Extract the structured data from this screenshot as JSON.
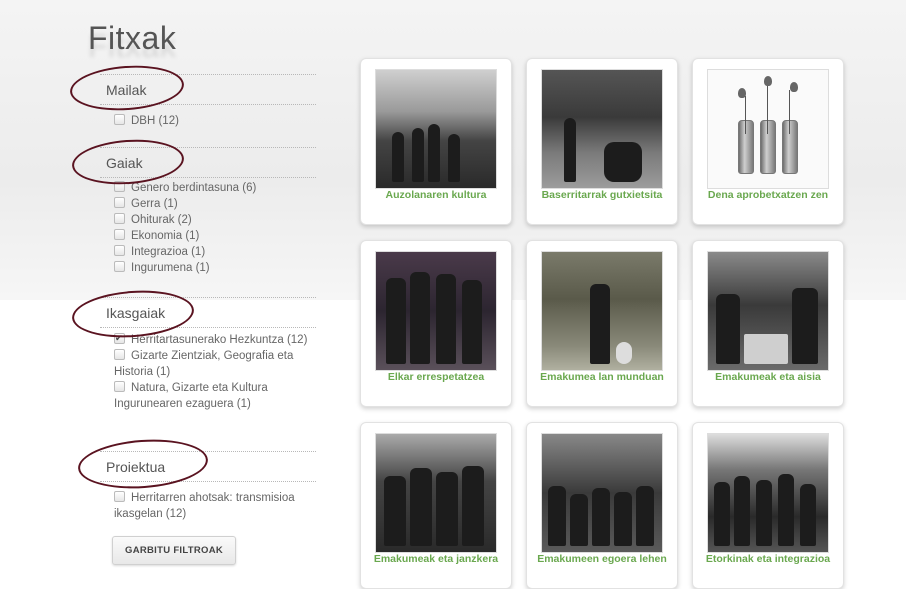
{
  "page": {
    "title": "Fitxak"
  },
  "filters": [
    {
      "heading": "Mailak",
      "items": [
        {
          "label": "DBH (12)",
          "checked": false
        }
      ]
    },
    {
      "heading": "Gaiak",
      "items": [
        {
          "label": "Genero berdintasuna (6)",
          "checked": false
        },
        {
          "label": "Gerra (1)",
          "checked": false
        },
        {
          "label": "Ohiturak (2)",
          "checked": false
        },
        {
          "label": "Ekonomia (1)",
          "checked": false
        },
        {
          "label": "Integrazioa (1)",
          "checked": false
        },
        {
          "label": "Ingurumena (1)",
          "checked": false
        }
      ]
    },
    {
      "heading": "Ikasgaiak",
      "items": [
        {
          "label": "Herritartasunerako Hezkuntza (12)",
          "checked": true
        },
        {
          "label": "Gizarte Zientziak, Geografia eta Historia (1)",
          "checked": false
        },
        {
          "label": "Natura, Gizarte eta Kultura Ingurunearen ezaguera (1)",
          "checked": false
        }
      ]
    },
    {
      "heading": "Proiektua",
      "items": [
        {
          "label": "Herritarren ahotsak: transmisioa ikasgelan (12)",
          "checked": false
        }
      ]
    }
  ],
  "reset_button": {
    "label": "GARBITU FILTROAK"
  },
  "cards": [
    {
      "caption": "Auzolanaren kultura"
    },
    {
      "caption": "Baserritarrak gutxietsita"
    },
    {
      "caption": "Dena aprobetxatzen zen"
    },
    {
      "caption": "Elkar errespetatzea"
    },
    {
      "caption": "Emakumea lan munduan"
    },
    {
      "caption": "Emakumeak eta aisia"
    },
    {
      "caption": "Emakumeak eta janzkera"
    },
    {
      "caption": "Emakumeen egoera lehen"
    },
    {
      "caption": "Etorkinak eta integrazioa"
    }
  ],
  "colors": {
    "annotation_circle": "#5a1320",
    "caption_green": "#6aa84f"
  }
}
